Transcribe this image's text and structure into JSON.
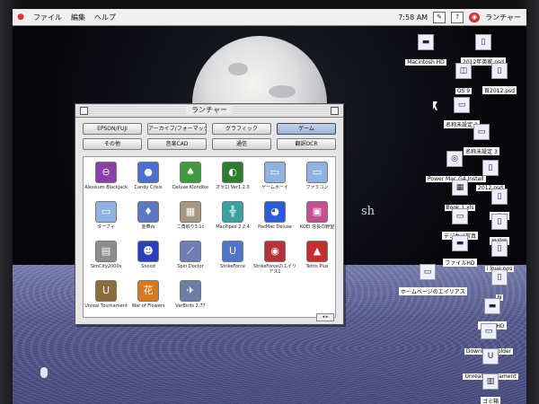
{
  "menubar": {
    "menus": [
      "ファイル",
      "編集",
      "ヘルプ"
    ],
    "time": "7:58 AM",
    "app_name": "ランチャー"
  },
  "wallpaper": {
    "text": "sh"
  },
  "launcher": {
    "title": "ランチャー",
    "categories": [
      "EPSON/FUJI",
      "アーカイブ/フォーマッタ",
      "グラフィック",
      "ゲーム",
      "その他",
      "音楽CAD",
      "通信",
      "翻訳OCR"
    ],
    "active_category": "ゲーム",
    "apps": [
      {
        "label": "Alessium BlackJack",
        "icon": "blackjack-icon",
        "glyph": "⊖",
        "color": "#8b3fa8"
      },
      {
        "label": "Candy Crisis",
        "icon": "candy-crisis-icon",
        "glyph": "●",
        "color": "#4a6fd1"
      },
      {
        "label": "Deluxe Klondike",
        "icon": "klondike-icon",
        "glyph": "♠",
        "color": "#3f9a3f"
      },
      {
        "label": "オセロ Ver1.2.0",
        "icon": "othello-icon",
        "glyph": "◐",
        "color": "#2f7d2f"
      },
      {
        "label": "ゲームボーイ",
        "icon": "folder-icon",
        "glyph": "▭",
        "color": "#8fb3e0"
      },
      {
        "label": "ファミコン",
        "icon": "folder-icon",
        "glyph": "▭",
        "color": "#8fb3e0"
      },
      {
        "label": "ターフィ",
        "icon": "folder-icon",
        "glyph": "▭",
        "color": "#8fb3e0"
      },
      {
        "label": "金華百",
        "icon": "card-game-icon",
        "glyph": "♦",
        "color": "#5a79c4"
      },
      {
        "label": "二角取り3.1c",
        "icon": "shisen-icon",
        "glyph": "▦",
        "color": "#a59a7d"
      },
      {
        "label": "MacPipes 2.2.4",
        "icon": "macpipes-icon",
        "glyph": "╬",
        "color": "#3aa0a0"
      },
      {
        "label": "PacMac Deluxe",
        "icon": "pacmac-icon",
        "glyph": "◕",
        "color": "#2b5bd6"
      },
      {
        "label": "KOEI 信長の野望",
        "icon": "koei-icon",
        "glyph": "▣",
        "color": "#c74f8f"
      },
      {
        "label": "SimCity2000s",
        "icon": "simcity-icon",
        "glyph": "▤",
        "color": "#8d8d8d"
      },
      {
        "label": "Snood",
        "icon": "snood-icon",
        "glyph": "☻",
        "color": "#2a3fbf"
      },
      {
        "label": "Spin Doctor",
        "icon": "spin-doctor-icon",
        "glyph": "⟋",
        "color": "#6e7fb3"
      },
      {
        "label": "StrikeForce",
        "icon": "strikeforce-icon",
        "glyph": "U",
        "color": "#4f75c8"
      },
      {
        "label": "StrikeForceのエイリアス1",
        "icon": "strikeforce-alias-icon",
        "glyph": "◉",
        "color": "#b8323a"
      },
      {
        "label": "Tetris Plus",
        "icon": "tetris-icon",
        "glyph": "▲",
        "color": "#c42e2e"
      },
      {
        "label": "Unreal Tournament",
        "icon": "unreal-icon",
        "glyph": "U",
        "color": "#8a6d3b"
      },
      {
        "label": "War of Flowers",
        "icon": "hanafuda-icon",
        "glyph": "花",
        "color": "#d77a1c"
      },
      {
        "label": "VarBirds 2.77",
        "icon": "varbirds-icon",
        "glyph": "✈",
        "color": "#6b7ea6"
      }
    ]
  },
  "desktop_icons": [
    {
      "label": "Macintosh HD",
      "icon": "hard-disk-icon",
      "glyph": "▬"
    },
    {
      "label": "2012年英家.psd",
      "icon": "document-icon",
      "glyph": "▯"
    },
    {
      "label": "OS 9",
      "icon": "os9-icon",
      "glyph": "◫"
    },
    {
      "label": "首2012.psd",
      "icon": "document-icon",
      "glyph": "▯"
    },
    {
      "label": "名称未設定 2",
      "icon": "folder-icon",
      "glyph": "▭"
    },
    {
      "label": "名称未設定 3",
      "icon": "folder-icon",
      "glyph": "▭"
    },
    {
      "label": "Power Mac G4 Install",
      "icon": "cd-icon",
      "glyph": "◎"
    },
    {
      "label": "2012.psd",
      "icon": "document-icon",
      "glyph": "▯"
    },
    {
      "label": "Book 1.xls",
      "icon": "spreadsheet-icon",
      "glyph": "▦"
    },
    {
      "label": "直役所",
      "icon": "document-icon",
      "glyph": "▯"
    },
    {
      "label": "デジカメ写真",
      "icon": "folder-icon",
      "glyph": "▭"
    },
    {
      "label": "徐役所",
      "icon": "document-icon",
      "glyph": "▯"
    },
    {
      "label": "ファイルHD",
      "icon": "hard-disk-icon",
      "glyph": "▬"
    },
    {
      "label": "i love pos",
      "icon": "document-icon",
      "glyph": "▯"
    },
    {
      "label": "ホームページのエイリアス",
      "icon": "folder-alias-icon",
      "glyph": "▭"
    },
    {
      "label": "N",
      "icon": "document-icon",
      "glyph": "▯"
    },
    {
      "label": "アプリHD",
      "icon": "hard-disk-icon",
      "glyph": "▬"
    },
    {
      "label": "Download Folder",
      "icon": "folder-icon",
      "glyph": "▭"
    },
    {
      "label": "Unreal Tournament",
      "icon": "unreal-icon",
      "glyph": "U"
    },
    {
      "label": "ゴミ箱",
      "icon": "trash-icon",
      "glyph": "▥"
    }
  ]
}
